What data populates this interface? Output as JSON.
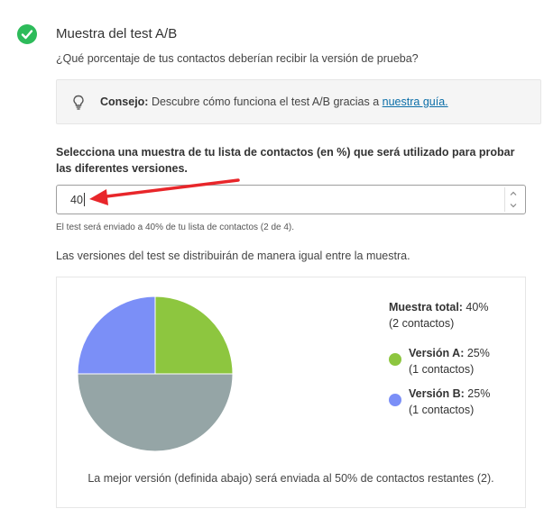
{
  "section": {
    "title": "Muestra del test A/B",
    "question": "¿Qué porcentaje de tus contactos deberían recibir la versión de prueba?"
  },
  "tip": {
    "label": "Consejo:",
    "text": " Descubre cómo funciona el test A/B gracias a ",
    "link": "nuestra guía."
  },
  "sample": {
    "label": "Selecciona una muestra de tu lista de contactos (en %) que será utilizado para probar las diferentes versiones.",
    "input_value": "40",
    "hint": "El test será enviado a 40% de tu lista de contactos (2 de 4).",
    "distribution_note": "Las versiones del test se distribuirán de manera igual entre la muestra."
  },
  "legend": {
    "total_label": "Muestra total:",
    "total_value": " 40%",
    "total_count": "(2 contactos)",
    "version_a_label": "Versión A:",
    "version_a_value": " 25%",
    "version_a_count": "(1 contactos)",
    "version_b_label": "Versión B:",
    "version_b_value": " 25%",
    "version_b_count": "(1 contactos)"
  },
  "footer": "La mejor versión (definida abajo) será enviada al 50% de contactos restantes (2).",
  "colors": {
    "success": "#2dbb5a",
    "version_a": "#8dc63f",
    "version_b": "#7b8ff7",
    "remaining": "#95a5a6",
    "annotation_arrow": "#e8262a"
  },
  "icons": {
    "status": "check-circle-icon",
    "tip": "lightbulb-icon"
  },
  "chart_data": {
    "type": "pie",
    "slices": [
      {
        "label": "Versión A",
        "value": 25
      },
      {
        "label": "Restantes",
        "value": 50
      },
      {
        "label": "Versión B",
        "value": 25
      }
    ]
  }
}
